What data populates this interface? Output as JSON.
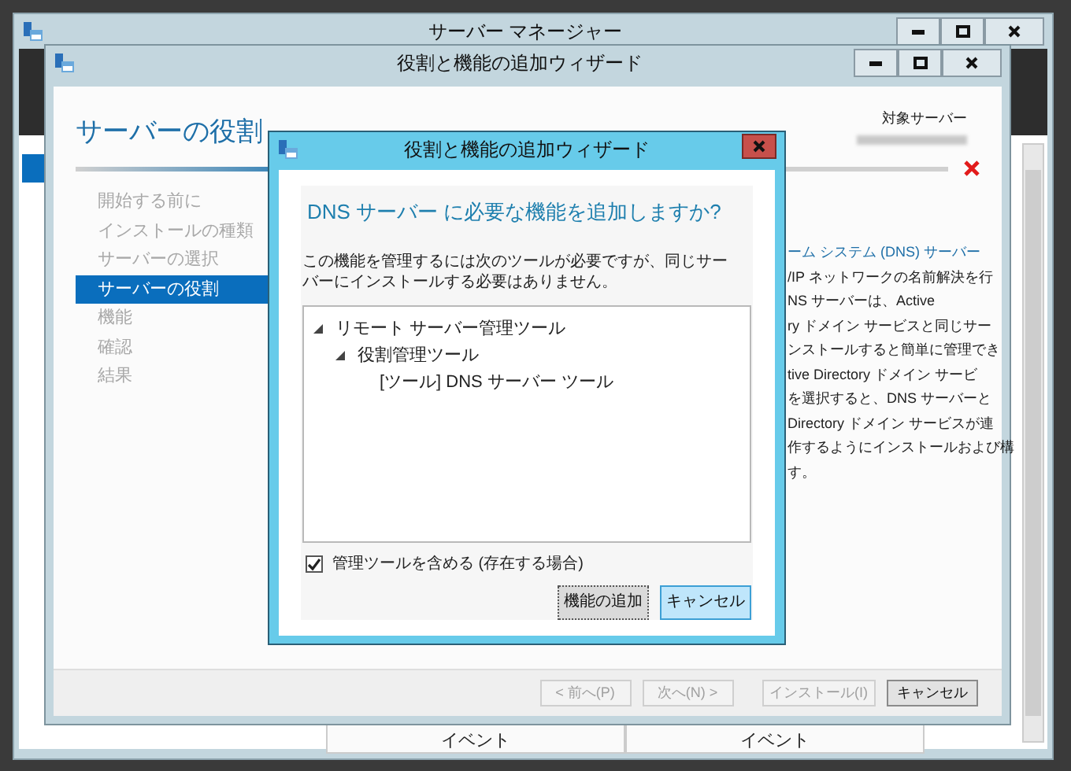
{
  "server_manager": {
    "title": "サーバー マネージャー",
    "table_headers": [
      "イベント",
      "イベント"
    ]
  },
  "wizard": {
    "title": "役割と機能の追加ウィザード",
    "heading": "サーバーの役割",
    "target_server_label": "対象サーバー",
    "steps": [
      {
        "label": "開始する前に",
        "selected": false
      },
      {
        "label": "インストールの種類",
        "selected": false
      },
      {
        "label": "サーバーの選択",
        "selected": false
      },
      {
        "label": "サーバーの役割",
        "selected": true
      },
      {
        "label": "機能",
        "selected": false
      },
      {
        "label": "確認",
        "selected": false
      },
      {
        "label": "結果",
        "selected": false
      }
    ],
    "description": [
      {
        "kind": "link",
        "text": "ーム システム (DNS) サーバー"
      },
      {
        "kind": "text",
        "text": "/IP ネットワークの名前解決を行"
      },
      {
        "kind": "text",
        "text": "NS サーバーは、Active"
      },
      {
        "kind": "text",
        "text": "ry ドメイン サービスと同じサー"
      },
      {
        "kind": "text",
        "text": "ンストールすると簡単に管理でき"
      },
      {
        "kind": "text",
        "text": "tive Directory ドメイン サービ"
      },
      {
        "kind": "text",
        "text": "を選択すると、DNS サーバーと"
      },
      {
        "kind": "text",
        "text": "Directory ドメイン サービスが連"
      },
      {
        "kind": "text",
        "text": "作するようにインストールおよび構"
      },
      {
        "kind": "text",
        "text": "す。"
      }
    ],
    "buttons": [
      {
        "label": "< 前へ(P)",
        "disabled": true
      },
      {
        "label": "次へ(N) >",
        "disabled": true
      },
      {
        "label": "インストール(I)",
        "disabled": true
      },
      {
        "label": "キャンセル",
        "disabled": false
      }
    ]
  },
  "dialog": {
    "title": "役割と機能の追加ウィザード",
    "question": "DNS サーバー に必要な機能を追加しますか?",
    "message": "この機能を管理するには次のツールが必要ですが、同じサーバーにインストールする必要はありません。",
    "tree": [
      {
        "label": "リモート サーバー管理ツール",
        "expanded": true,
        "children": [
          {
            "label": "役割管理ツール",
            "expanded": true,
            "children": [
              {
                "label": "[ツール] DNS サーバー ツール"
              }
            ]
          }
        ]
      }
    ],
    "include_tools": {
      "label": "管理ツールを含める (存在する場合)",
      "checked": true
    },
    "buttons": [
      {
        "label": "機能の追加",
        "default": true
      },
      {
        "label": "キャンセル",
        "default": false
      }
    ]
  }
}
